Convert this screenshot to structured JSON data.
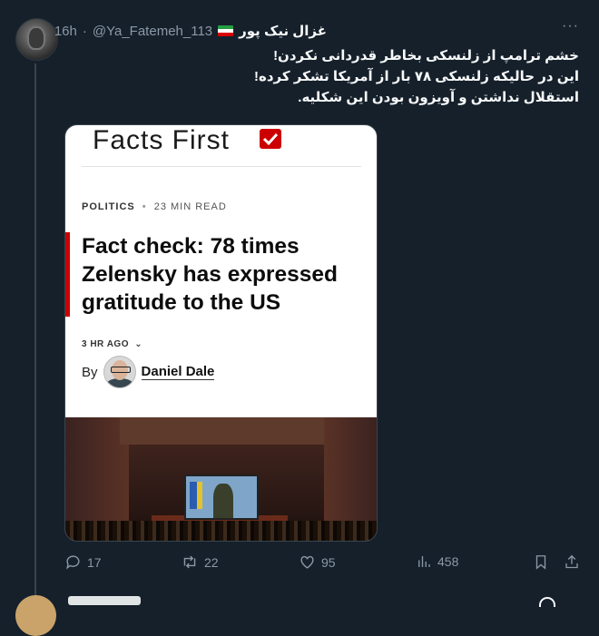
{
  "tweet": {
    "display_name": "غزال نیک پور",
    "handle": "@Ya_Fatemeh_113",
    "separator": "·",
    "time": "16h",
    "text_lines": [
      "خشم ترامپ از زلنسکی بخاطر قدردانی نکردن!",
      "این در حالیکه زلنسکی ۷۸ بار از آمریکا تشکر کرده!",
      "استقلال نداشتن و آویزون بودن این شکلیه."
    ]
  },
  "card": {
    "brand": "Facts First",
    "section": "POLITICS",
    "read_time": "23 MIN READ",
    "headline": "Fact check: 78 times Zelensky has expressed gratitude to the US",
    "time_ago": "3 HR AGO",
    "by": "By",
    "author": "Daniel Dale"
  },
  "actions": {
    "replies": "17",
    "reposts": "22",
    "likes": "95",
    "views": "458"
  },
  "colors": {
    "background": "#15202b",
    "text": "#f7f9f9",
    "muted": "#8b98a5",
    "cnn_red": "#cc0000"
  }
}
